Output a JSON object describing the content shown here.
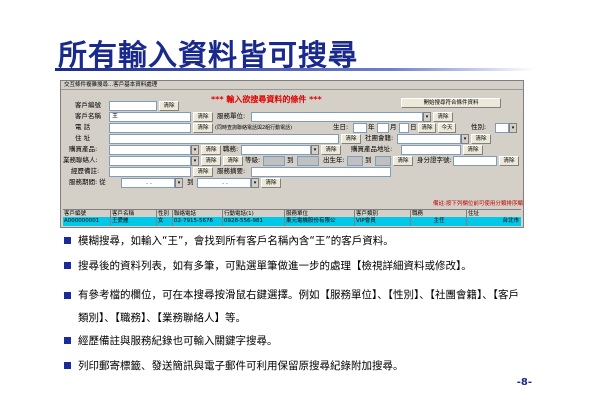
{
  "slide": {
    "title": "所有輸入資料皆可搜尋",
    "page_number": "-8-"
  },
  "window": {
    "title": "交互條件複雜搜尋...客戶基本資料處理",
    "prompt": "*** 輸入欲搜尋資料的條件 ***",
    "start_search_button": "開始搜尋符合條件資料",
    "clear_label": "清除",
    "fields": {
      "customer_id": "客戶編號",
      "customer_name": "客戶名稱",
      "customer_name_value": "王",
      "service_unit": "服務單位:",
      "phone": "電 話",
      "phone_note": "(同時查詢聯絡電話與2組行動電話)",
      "birthday": "生日:",
      "year": "年",
      "month": "月",
      "day": "日",
      "today": "今天",
      "gender": "性別:",
      "address": "住 址",
      "society": "社團會籍:",
      "product": "購買產品:",
      "job": "職務:",
      "product_location": "購買產品地址:",
      "sales_contact": "業務聯絡人:",
      "level": "等級:",
      "birth_year": "出生年:",
      "id_number": "身分證字號:",
      "history_notes": "經歷備註:",
      "service_record": "服務摘要:",
      "service_period": "服務期間: 從",
      "to": "到",
      "date_mask": ". ."
    },
    "hint": "備註:按下列欄位前可使用分類排序顯示",
    "grid": {
      "headers": [
        "客戶編號",
        "客戶名稱",
        "性別",
        "聯絡電話",
        "行動電話(1)",
        "服務單位",
        "客戶類別",
        "職務",
        "住址"
      ],
      "rows": [
        [
          "A000000001",
          "王愛麗",
          "女",
          "02-7915-5676",
          "0928-556-981",
          "東元電機股份有限公",
          "VIP會員",
          "主任",
          "台北市"
        ]
      ]
    }
  },
  "bullets": [
    "模糊搜尋，如輸入“王”，會找到所有客戶名稱內含“王”的客戶資料。",
    "搜尋後的資料列表，如有多筆，可點選單筆做進一步的處理【檢視詳細資料或修改】。",
    "有參考檔的欄位，可在本搜尋按滑鼠右鍵選擇。例如【服務單位】、【性別】、【社團會籍】、【客戶類別】、【職務】、【業務聯絡人】等。",
    "經歷備註與服務紀錄也可輸入關鍵字搜尋。",
    "列印郵寄標籤、發送簡訊與電子郵件可利用保留原搜尋紀錄附加搜尋。"
  ]
}
